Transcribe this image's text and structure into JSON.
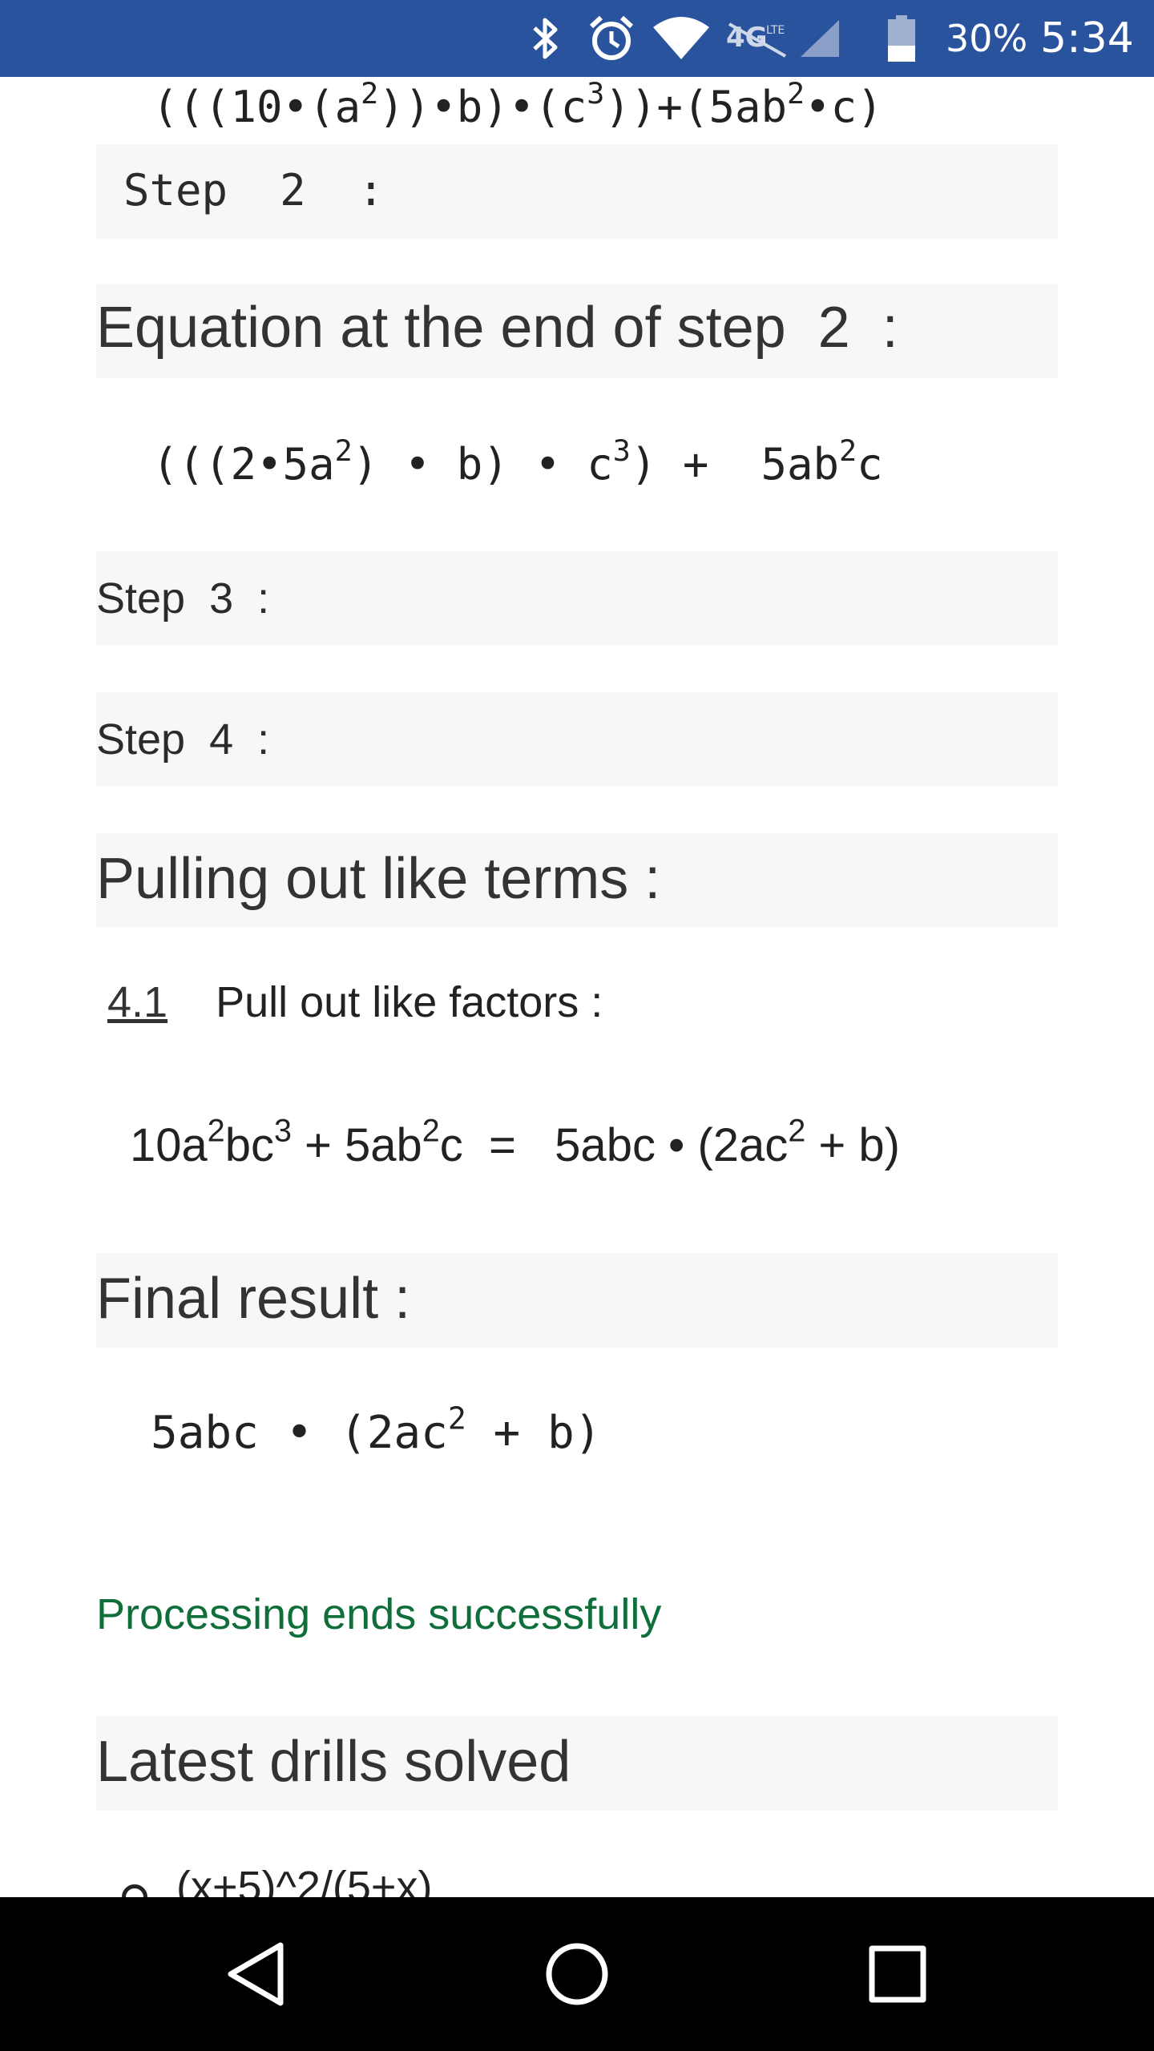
{
  "status_bar": {
    "battery_percent": "30%",
    "time": "5:34",
    "icons": [
      "bluetooth-icon",
      "alarm-icon",
      "wifi-icon",
      "4g-lte-icon",
      "signal-icon",
      "battery-icon"
    ],
    "background": "#2a539d"
  },
  "content": {
    "top_expression": {
      "prefix": "(((10•(a",
      "sup1": "2",
      "mid1": "))•b)•(c",
      "sup2": "3",
      "mid2": "))+(5ab",
      "sup3": "2",
      "suffix": "•c)"
    },
    "step2_label": "Step  2  :",
    "eq_end_step2_heading": "Equation at the end of step  2  :",
    "step2_expression": {
      "prefix": "(((2•5a",
      "sup1": "2",
      "mid1": ") • b) • c",
      "sup2": "3",
      "mid2": ") +  5ab",
      "sup3": "2",
      "suffix": "c"
    },
    "step3_label": "Step  3  :",
    "step4_label": "Step  4  :",
    "pulling_heading": "Pulling out like terms :",
    "sub_number": "4.1",
    "sub_title": "Pull out like factors :",
    "factor_expression": {
      "p1": "10a",
      "s1": "2",
      "p2": "bc",
      "s2": "3",
      "p3": " + 5ab",
      "s3": "2",
      "p4": "c  =   5abc • (2ac",
      "s4": "2",
      "p5": " + b)"
    },
    "final_heading": "Final result :",
    "final_expression": {
      "prefix": "5abc • (2ac",
      "sup": "2",
      "suffix": " + b)"
    },
    "success_message": "Processing ends successfully",
    "latest_heading": "Latest drills solved",
    "drills": [
      "(x+5)^2/(5+x)"
    ]
  },
  "nav_bar": {
    "buttons": [
      "back-button",
      "home-button",
      "recents-button"
    ]
  },
  "colors": {
    "success": "#0f6e3a",
    "band": "#f7f7f7",
    "status": "#2a539d"
  }
}
